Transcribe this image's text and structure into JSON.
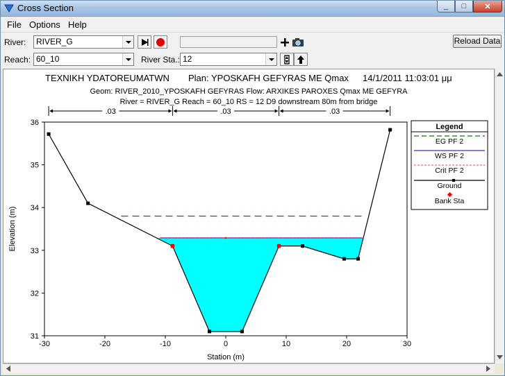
{
  "window": {
    "title": "Cross Section",
    "min": "_",
    "max": "□",
    "close": "✕"
  },
  "menu": {
    "file": "File",
    "options": "Options",
    "help": "Help"
  },
  "controls": {
    "river_label": "River:",
    "river_value": "RIVER_G",
    "reach_label": "Reach:",
    "reach_value": "60_10",
    "station_label": "River Sta.:",
    "station_value": "12",
    "reload_label": "Reload Data"
  },
  "plot": {
    "title_left": "TEXNIKH YDATOREUMATWN",
    "title_plan": "Plan: YPOSKAFH GEFYRAS ME Qmax",
    "title_date": "14/1/2011   11:03:01 μμ",
    "geom_line": "Geom: RIVER_2010_YPOSKAFH GEFYRAS      Flow: ARXIKES PAROXES Qmax ME GEFYRA",
    "info_line": "River = RIVER_G    Reach = 60_10       RS = 12    D9 downstream 80m from bridge",
    "n_values": [
      ".03",
      ".03",
      ".03"
    ]
  },
  "legend": {
    "title": "Legend",
    "items": [
      "EG PF 2",
      "WS PF 2",
      "Crit PF 2",
      "Ground",
      "Bank Sta"
    ]
  },
  "chart_data": {
    "type": "line",
    "xlabel": "Station (m)",
    "ylabel": "Elevation (m)",
    "xlim": [
      -30,
      30
    ],
    "ylim": [
      31,
      36
    ],
    "xticks": [
      -30,
      -20,
      -10,
      0,
      10,
      20,
      30
    ],
    "yticks": [
      31,
      32,
      33,
      34,
      35,
      36
    ],
    "grid": false,
    "legend_position": "right",
    "ground": {
      "x": [
        -29.3,
        -22.8,
        -8.8,
        -2.7,
        2.7,
        8.8,
        12.7,
        19.6,
        21.9,
        27.2
      ],
      "y": [
        35.72,
        34.1,
        33.1,
        31.1,
        31.1,
        33.1,
        33.1,
        32.8,
        32.8,
        35.82
      ]
    },
    "bank_stations": {
      "x": [
        -8.8,
        8.8
      ],
      "y": [
        33.1,
        33.1
      ]
    },
    "water_surface": {
      "elevation": 33.29,
      "x_left": -10.9,
      "x_right": 22.6
    },
    "energy_grade": {
      "elevation": 33.8,
      "x_left": -17.3,
      "x_right": 22.6
    },
    "critical": {
      "elevation": 33.29
    },
    "n_regions_x": [
      -29.3,
      -8.8,
      8.8,
      27.2
    ],
    "colors": {
      "water": "#00ffff",
      "energy_grade": "#008000",
      "water_surface": "#0000ff",
      "critical": "#ff0000",
      "ground": "#000000",
      "bank": "#ff0000"
    }
  }
}
